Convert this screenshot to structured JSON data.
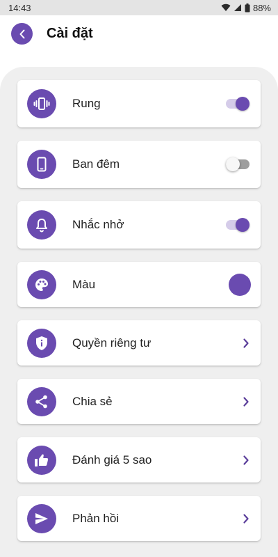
{
  "status_bar": {
    "time": "14:43",
    "battery": "88%",
    "icons": [
      "wifi-icon",
      "signal-icon",
      "battery-icon"
    ]
  },
  "header": {
    "title": "Cài đặt",
    "back_icon": "chevron-left-icon"
  },
  "colors": {
    "accent": "#6a4bb0",
    "toggle_track_on": "#d5cce9",
    "panel_bg": "#efefef"
  },
  "settings": [
    {
      "label": "Rung",
      "icon": "vibration-icon",
      "control": "toggle",
      "value": true
    },
    {
      "label": "Ban đêm",
      "icon": "phone-icon",
      "control": "toggle",
      "value": false
    },
    {
      "label": "Nhắc nhở",
      "icon": "bell-icon",
      "control": "toggle",
      "value": true
    },
    {
      "label": "Màu",
      "icon": "palette-icon",
      "control": "color",
      "value": "#6a4bb0"
    },
    {
      "label": "Quyền riêng tư",
      "icon": "shield-info-icon",
      "control": "chevron"
    },
    {
      "label": "Chia sẻ",
      "icon": "share-icon",
      "control": "chevron"
    },
    {
      "label": "Đánh giá 5 sao",
      "icon": "thumbs-up-icon",
      "control": "chevron"
    },
    {
      "label": "Phản hồi",
      "icon": "send-icon",
      "control": "chevron"
    }
  ]
}
